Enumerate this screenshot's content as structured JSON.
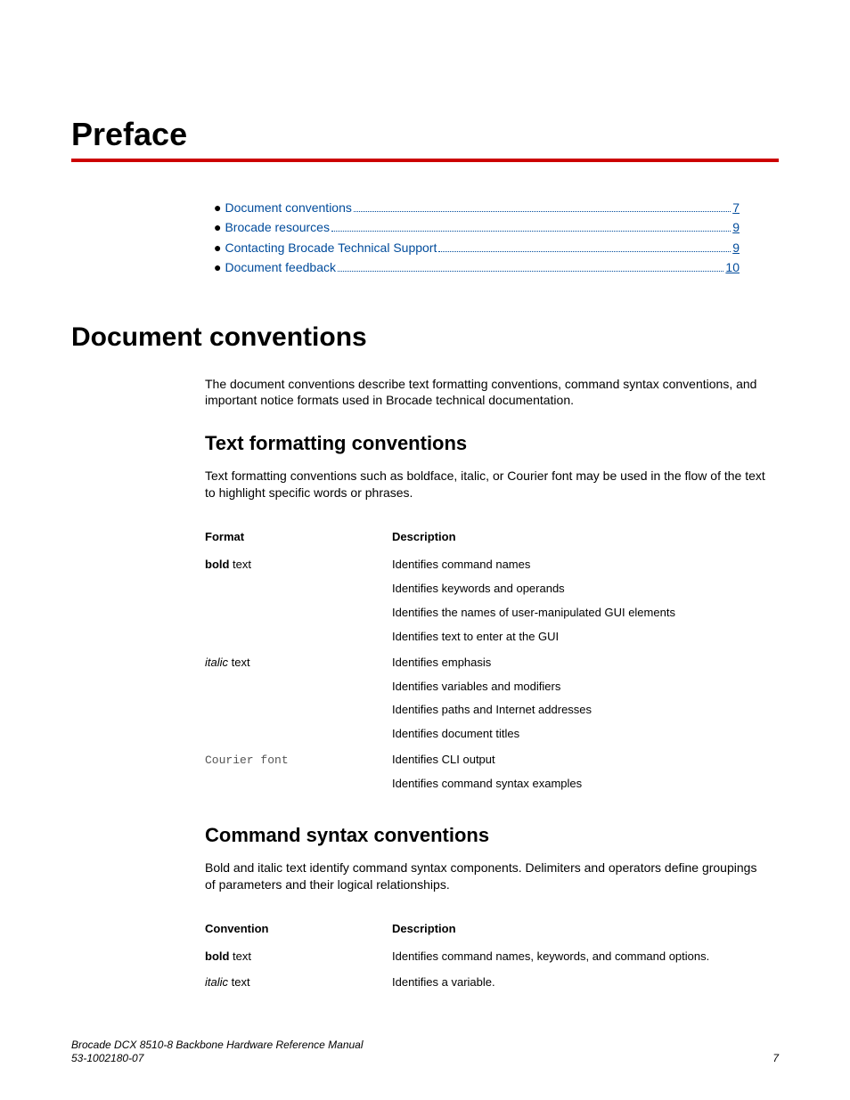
{
  "chapter": {
    "title": "Preface"
  },
  "toc": {
    "items": [
      {
        "label": "Document conventions",
        "page": "7"
      },
      {
        "label": "Brocade resources",
        "page": "9"
      },
      {
        "label": "Contacting Brocade Technical Support",
        "page": "9"
      },
      {
        "label": "Document feedback",
        "page": "10"
      }
    ]
  },
  "section1": {
    "title": "Document conventions",
    "intro": "The document conventions describe text formatting conventions, command syntax conventions, and important notice formats used in Brocade technical documentation."
  },
  "textfmt": {
    "title": "Text formatting conventions",
    "intro": "Text formatting conventions such as boldface, italic, or Courier font may be used in the flow of the text to highlight specific words or phrases.",
    "headers": {
      "format": "Format",
      "description": "Description"
    },
    "rows": [
      {
        "format_prefix": "bold",
        "format_suffix": " text",
        "desc": [
          "Identifies command names",
          "Identifies keywords and operands",
          "Identifies the names of user-manipulated GUI elements",
          "Identifies text to enter at the GUI"
        ]
      },
      {
        "format_prefix": "italic",
        "format_suffix": " text",
        "desc": [
          "Identifies emphasis",
          "Identifies variables and modifiers",
          "Identifies paths and Internet addresses",
          "Identifies document titles"
        ]
      },
      {
        "format_prefix": "Courier font",
        "format_suffix": "",
        "desc": [
          "Identifies CLI output",
          "Identifies command syntax examples"
        ]
      }
    ]
  },
  "cmdsyn": {
    "title": "Command syntax conventions",
    "intro": "Bold and italic text identify command syntax components. Delimiters and operators define groupings of parameters and their logical relationships.",
    "headers": {
      "convention": "Convention",
      "description": "Description"
    },
    "rows": [
      {
        "format_prefix": "bold",
        "format_suffix": " text",
        "desc": "Identifies command names, keywords, and command options."
      },
      {
        "format_prefix": "italic",
        "format_suffix": " text",
        "desc": "Identifies a variable."
      }
    ]
  },
  "footer": {
    "title": "Brocade DCX 8510-8 Backbone Hardware Reference Manual",
    "docnum": "53-1002180-07",
    "page": "7"
  }
}
